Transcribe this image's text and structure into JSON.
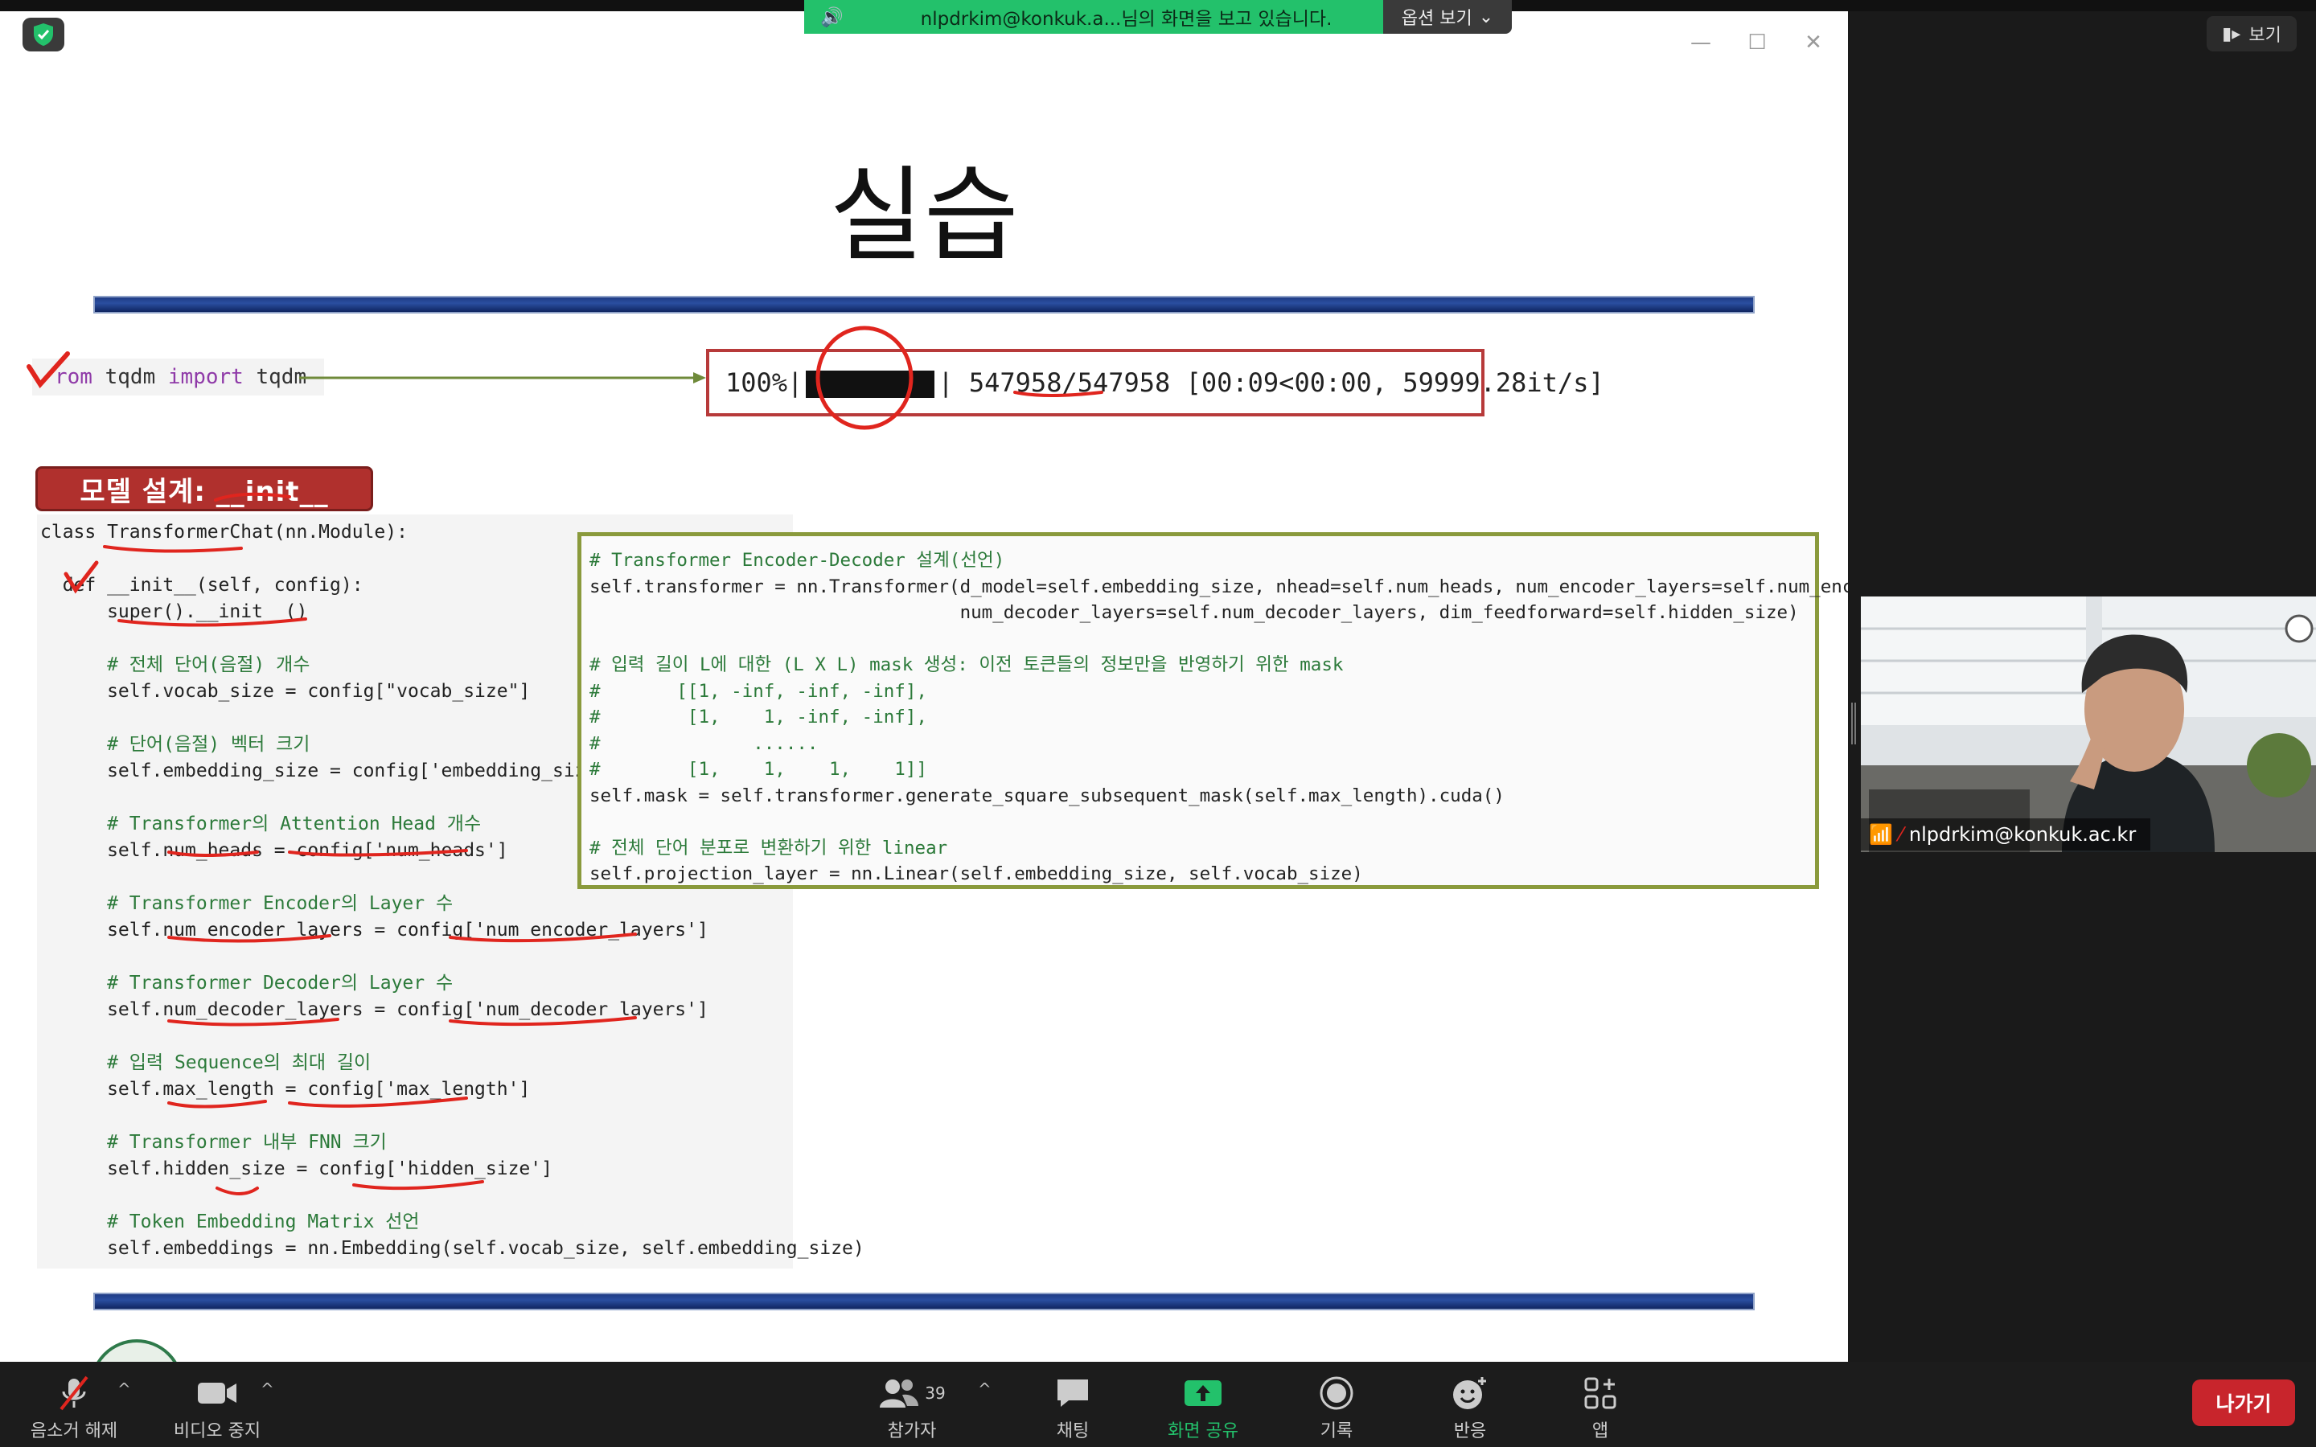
{
  "share_banner": {
    "text": "nlpdrkim@konkuk.a...님의 화면을 보고 있습니다.",
    "options_label": "옵션 보기"
  },
  "view_button": {
    "label": "보기"
  },
  "slide": {
    "title": "실습",
    "tqdm_import": {
      "prefix": "rom ",
      "kw_from": "",
      "mid": "tqdm ",
      "kw_import": "import",
      "suffix": " tqdm"
    },
    "progress": {
      "percent_text": "100%|",
      "fraction": 1.0,
      "counts": "547958/547958",
      "timing": "[00:09<00:00, 59999.28it/s]"
    },
    "section_label": "모델 설계: __init__",
    "left_code": [
      "class TransformerChat(nn.Module):",
      "",
      "  def __init__(self, config):",
      "      super().__init__()",
      "",
      "      # 전체 단어(음절) 개수",
      "      self.vocab_size = config[\"vocab_size\"]",
      "",
      "      # 단어(음절) 벡터 크기",
      "      self.embedding_size = config['embedding_size']",
      "",
      "      # Transformer의 Attention Head 개수",
      "      self.num_heads = config['num_heads']",
      "",
      "      # Transformer Encoder의 Layer 수",
      "      self.num_encoder_layers = config['num_encoder_layers']",
      "",
      "      # Transformer Decoder의 Layer 수",
      "      self.num_decoder_layers = config['num_decoder_layers']",
      "",
      "      # 입력 Sequence의 최대 길이",
      "      self.max_length = config['max_length']",
      "",
      "      # Transformer 내부 FNN 크기",
      "      self.hidden_size = config['hidden_size']",
      "",
      "      # Token Embedding Matrix 선언",
      "      self.embeddings = nn.Embedding(self.vocab_size, self.embedding_size)"
    ],
    "right_code": [
      "# Transformer Encoder-Decoder 설계(선언)",
      "self.transformer = nn.Transformer(d_model=self.embedding_size, nhead=self.num_heads, num_encoder_layers=self.num_encoder_layers,",
      "                                  num_decoder_layers=self.num_decoder_layers, dim_feedforward=self.hidden_size)",
      "",
      "# 입력 길이 L에 대한 (L X L) mask 생성: 이전 토큰들의 정보만을 반영하기 위한 mask",
      "#       [[1, -inf, -inf, -inf],",
      "#        [1,    1, -inf, -inf],",
      "#              ......",
      "#        [1,    1,    1,    1]]",
      "self.mask = self.transformer.generate_square_subsequent_mask(self.max_length).cuda()",
      "",
      "# 전체 단어 분포로 변환하기 위한 linear",
      "self.projection_layer = nn.Linear(self.embedding_size, self.vocab_size)"
    ]
  },
  "participant_video": {
    "name": "nlpdrkim@konkuk.ac.kr"
  },
  "toolbar": {
    "unmute": "음소거 해제",
    "video_stop": "비디오 중지",
    "participants": "참가자",
    "participants_count": "39",
    "chat": "채팅",
    "share_screen": "화면 공유",
    "record": "기록",
    "reactions": "반응",
    "apps": "앱",
    "leave": "나가기"
  },
  "colors": {
    "share_green": "#23c16b",
    "leave_red": "#c8252c",
    "slide_bar_blue": "#1f3c86",
    "section_red": "#b0302d"
  }
}
